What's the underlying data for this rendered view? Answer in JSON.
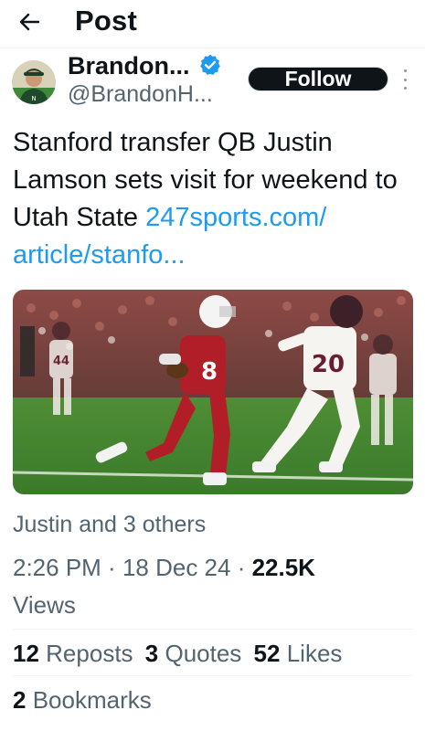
{
  "header": {
    "title": "Post",
    "back_icon": "arrow-left-icon"
  },
  "author": {
    "name": "Brandon...",
    "handle": "@BrandonH...",
    "verified_color": "#1d9bf0",
    "follow_label": "Follow"
  },
  "tweet": {
    "text": "Stanford transfer QB Justin Lamson sets visit for weekend to Utah State ",
    "link_text": "247sports.com/​article/stanfo...",
    "link_color": "#1d9bf0"
  },
  "media": {
    "jersey_runner": "8",
    "jersey_defender_1": "20",
    "jersey_defender_2": "44"
  },
  "tagged": "Justin and 3 others",
  "meta": {
    "time": "2:26 PM",
    "date": "18 Dec 24",
    "views_count": "22.5K",
    "views_label": "Views"
  },
  "stats": [
    {
      "count": "12",
      "label": "Reposts"
    },
    {
      "count": "3",
      "label": "Quotes"
    },
    {
      "count": "52",
      "label": "Likes"
    }
  ],
  "bookmarks": {
    "count": "2",
    "label": "Bookmarks"
  }
}
